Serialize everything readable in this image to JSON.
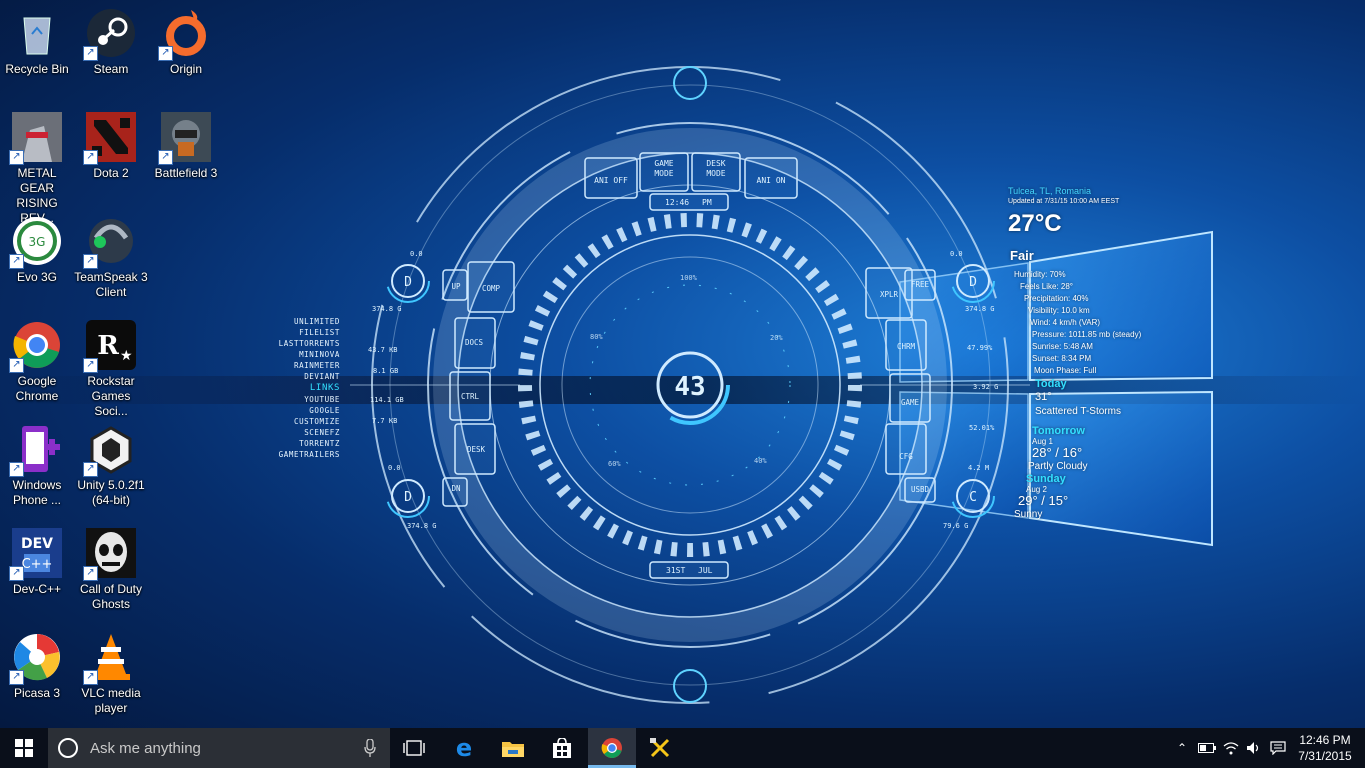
{
  "desktop_icons": [
    {
      "label": "Recycle Bin",
      "icon": "recycle-bin-icon",
      "shortcut": false
    },
    {
      "label": "Steam",
      "icon": "steam-icon",
      "shortcut": true
    },
    {
      "label": "Origin",
      "icon": "origin-icon",
      "shortcut": true
    },
    {
      "label": "METAL GEAR RISING REV...",
      "icon": "metal-gear-rising-icon",
      "shortcut": true
    },
    {
      "label": "Dota 2",
      "icon": "dota2-icon",
      "shortcut": true
    },
    {
      "label": "Battlefield 3",
      "icon": "battlefield3-icon",
      "shortcut": true
    },
    {
      "label": "Evo 3G",
      "icon": "evo3g-icon",
      "shortcut": true
    },
    {
      "label": "TeamSpeak 3 Client",
      "icon": "teamspeak-icon",
      "shortcut": true
    },
    {
      "label": "Google Chrome",
      "icon": "chrome-icon",
      "shortcut": true
    },
    {
      "label": "Rockstar Games Soci...",
      "icon": "rockstar-icon",
      "shortcut": true
    },
    {
      "label": "Windows Phone ...",
      "icon": "windows-phone-icon",
      "shortcut": true
    },
    {
      "label": "Unity 5.0.2f1 (64-bit)",
      "icon": "unity-icon",
      "shortcut": true
    },
    {
      "label": "Dev-C++",
      "icon": "devcpp-icon",
      "shortcut": true
    },
    {
      "label": "Call of Duty Ghosts",
      "icon": "cod-ghosts-icon",
      "shortcut": true
    },
    {
      "label": "Picasa 3",
      "icon": "picasa-icon",
      "shortcut": true
    },
    {
      "label": "VLC media player",
      "icon": "vlc-icon",
      "shortcut": true
    }
  ],
  "hud": {
    "time": "12:46",
    "ampm": "PM",
    "date_day": "31ST",
    "date_month": "JUL",
    "center_value": "43",
    "top_buttons": [
      "ANI OFF",
      "GAME MODE",
      "DESK MODE",
      "ANI ON"
    ],
    "left_buttons": [
      "UP",
      "COMP",
      "DOCS",
      "CTRL",
      "DESK",
      "DN"
    ],
    "right_buttons": [
      "XPLR",
      "FREE",
      "CHRM",
      "GAME",
      "CFG",
      "USBD"
    ],
    "ring_labels": [
      "100%",
      "80%",
      "20%",
      "60%",
      "40%"
    ],
    "disk_left_top": {
      "letter": "D",
      "used": "0.0",
      "size": "374.8 G"
    },
    "disk_left_bottom": {
      "letter": "D",
      "used": "0.0",
      "size": "374.8 G"
    },
    "disk_right_top": {
      "letter": "D",
      "used": "0.0",
      "size": "374.8 G"
    },
    "disk_right_bottom": {
      "letter": "C",
      "used": "4.2 M",
      "size": "79.6 G"
    },
    "net_left": [
      "43.7 KB",
      "8.1 GB",
      "114.1 GB",
      "7.7 KB"
    ],
    "net_right": [
      "47.99%",
      "3.92 G",
      "52.01%"
    ]
  },
  "links": [
    "UNLIMITED",
    "FILELIST",
    "LASTTORRENTS",
    "MININOVA",
    "RAINMETER",
    "DEVIANT"
  ],
  "links_header": "LINKS",
  "links2": [
    "YOUTUBE",
    "GOOGLE",
    "CUSTOMIZE",
    "SCENEFZ",
    "TORRENTZ",
    "GAMETRAILERS"
  ],
  "weather": {
    "location": "Tulcea, TL, Romania",
    "updated": "Updated at 7/31/15 10:00 AM EEST",
    "temp": "27°C",
    "condition": "Fair",
    "details": [
      "Humidity: 70%",
      "Feels Like: 28°",
      "Precipitation: 40%",
      "Visibility: 10.0 km",
      "Wind: 4 km/h (VAR)",
      "Pressure: 1011.85 mb (steady)",
      "Sunrise: 5:48 AM",
      "Sunset: 8:34 PM",
      "Moon Phase: Full"
    ],
    "today_label": "Today",
    "today_temp": "31°",
    "today_cond": "Scattered T-Storms",
    "tomorrow_label": "Tomorrow",
    "tomorrow_date": "Aug 1",
    "tomorrow_temp": "28° / 16°",
    "tomorrow_cond": "Partly Cloudy",
    "sunday_label": "Sunday",
    "sunday_date": "Aug 2",
    "sunday_temp": "29° / 15°",
    "sunday_cond": "Sunny"
  },
  "taskbar": {
    "search_placeholder": "Ask me anything",
    "time": "12:46 PM",
    "date": "7/31/2015"
  }
}
